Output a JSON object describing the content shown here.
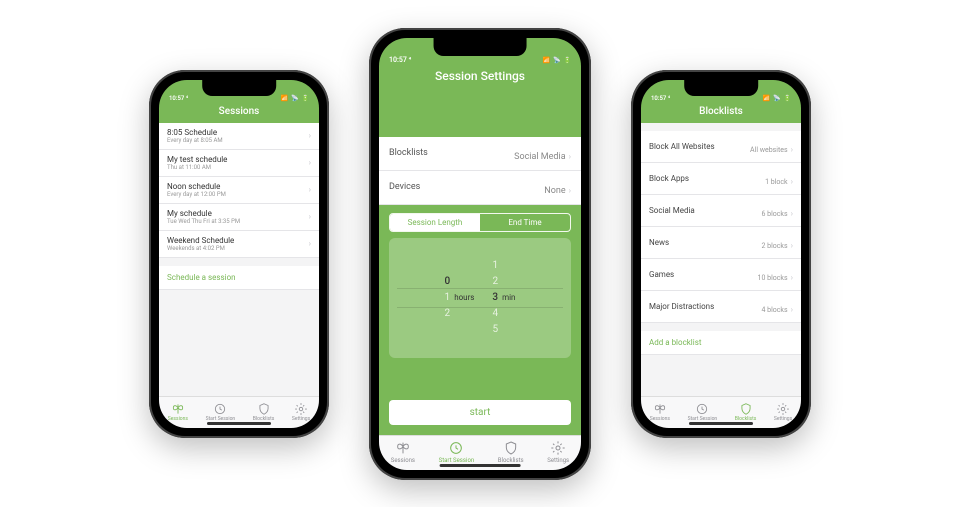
{
  "status_time": "10:57 ⁴",
  "phones": {
    "sessions": {
      "title": "Sessions",
      "items": [
        {
          "title": "8:05 Schedule",
          "sub": "Every day at 8:05 AM"
        },
        {
          "title": "My test schedule",
          "sub": "Thu at 11:00 AM"
        },
        {
          "title": "Noon schedule",
          "sub": "Every day at 12:00 PM"
        },
        {
          "title": "My schedule",
          "sub": "Tue Wed Thu Fri at 3:35 PM"
        },
        {
          "title": "Weekend Schedule",
          "sub": "Weekends at 4:02 PM"
        }
      ],
      "action": "Schedule a session"
    },
    "start": {
      "title": "Session Settings",
      "rows": [
        {
          "label": "Blocklists",
          "value": "Social Media"
        },
        {
          "label": "Devices",
          "value": "None"
        }
      ],
      "seg": {
        "a": "Session Length",
        "b": "End Time"
      },
      "picker": {
        "hours": {
          "above": [
            " ",
            " "
          ],
          "sel": "0",
          "below": [
            "1",
            "2"
          ],
          "label": "hours"
        },
        "mins": {
          "above": [
            "1",
            "2"
          ],
          "sel": "3",
          "below": [
            "4",
            "5"
          ],
          "label": "min"
        }
      },
      "start_label": "start"
    },
    "blocklists": {
      "title": "Blocklists",
      "items": [
        {
          "title": "Block All Websites",
          "value": "All websites"
        },
        {
          "title": "Block Apps",
          "value": "1 block"
        },
        {
          "title": "Social Media",
          "value": "6 blocks"
        },
        {
          "title": "News",
          "value": "2 blocks"
        },
        {
          "title": "Games",
          "value": "10 blocks"
        },
        {
          "title": "Major Distractions",
          "value": "4 blocks"
        }
      ],
      "action": "Add a blocklist"
    }
  },
  "tabs": {
    "sessions": "Sessions",
    "start": "Start Session",
    "blocklists": "Blocklists",
    "settings": "Settings"
  }
}
